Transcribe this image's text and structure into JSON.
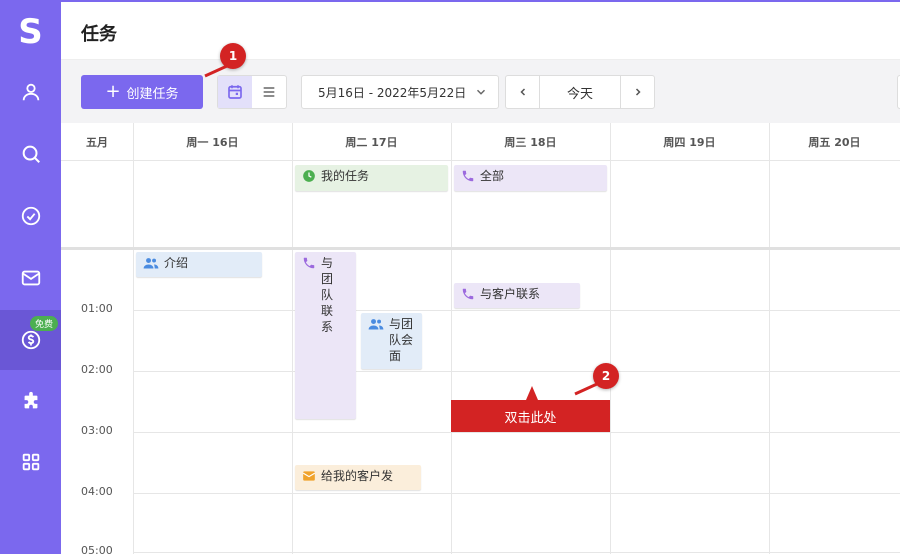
{
  "app": {
    "logo": "S",
    "page_title": "任务"
  },
  "sidebar": {
    "items": [
      {
        "icon": "person-icon"
      },
      {
        "icon": "search-icon"
      },
      {
        "icon": "check-circle-icon"
      },
      {
        "icon": "mail-icon"
      },
      {
        "icon": "dollar-circle-icon",
        "badge": "免费",
        "active": true
      },
      {
        "icon": "puzzle-icon"
      },
      {
        "icon": "grid-icon"
      }
    ]
  },
  "toolbar": {
    "create_label": "创建任务",
    "date_range": "5月16日 - 2022年5月22日",
    "today_label": "今天"
  },
  "calendar": {
    "month_label": "五月",
    "days": [
      "周一 16日",
      "周二 17日",
      "周三 18日",
      "周四 19日",
      "周五 20日"
    ],
    "times": [
      "01:00",
      "02:00",
      "03:00",
      "04:00",
      "05:00"
    ],
    "allday_events": [
      {
        "title": "我的任务",
        "type": "task",
        "color": "#4caf50"
      },
      {
        "title": "全部",
        "type": "call",
        "color": "#9c6ade"
      }
    ],
    "events": [
      {
        "title": "介绍",
        "type": "meeting"
      },
      {
        "title_chars": [
          "与",
          "团",
          "队",
          "联",
          "系"
        ],
        "type": "call"
      },
      {
        "title_chars": [
          "与团",
          "队会",
          "面"
        ],
        "type": "meeting"
      },
      {
        "title": "与客户联系",
        "type": "call"
      },
      {
        "title": "给我的客户发",
        "type": "email"
      }
    ]
  },
  "callouts": {
    "badge_1": "1",
    "badge_2": "2",
    "tooltip": "双击此处"
  }
}
